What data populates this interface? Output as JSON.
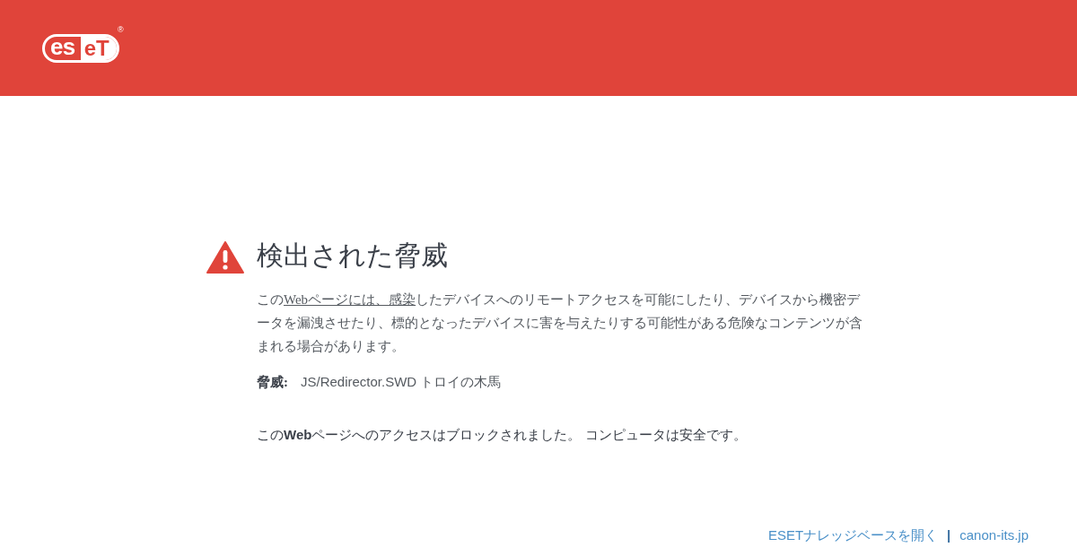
{
  "header": {
    "logo": {
      "left": "es",
      "right": "eT",
      "mark": "®"
    }
  },
  "warning": {
    "title": "検出された脅威",
    "description": {
      "before": "この",
      "link": "Webページには、感染",
      "after": "したデバイスへのリモートアクセスを可能にしたり、デバイスから機密データを漏洩させたり、標的となったデバイスに害を与えたりする可能性がある危険なコンテンツが含まれる場合があります。"
    },
    "threat": {
      "label": "脅威:",
      "value": "JS/Redirector.SWD トロイの木馬"
    },
    "blocked": "この**Web**ページへのアクセスはブロックされました。 コンピュータは安全です。"
  },
  "footer": {
    "links": [
      "ESETナレッジベースを開く",
      "canon-its.jp"
    ],
    "separator": "|"
  }
}
